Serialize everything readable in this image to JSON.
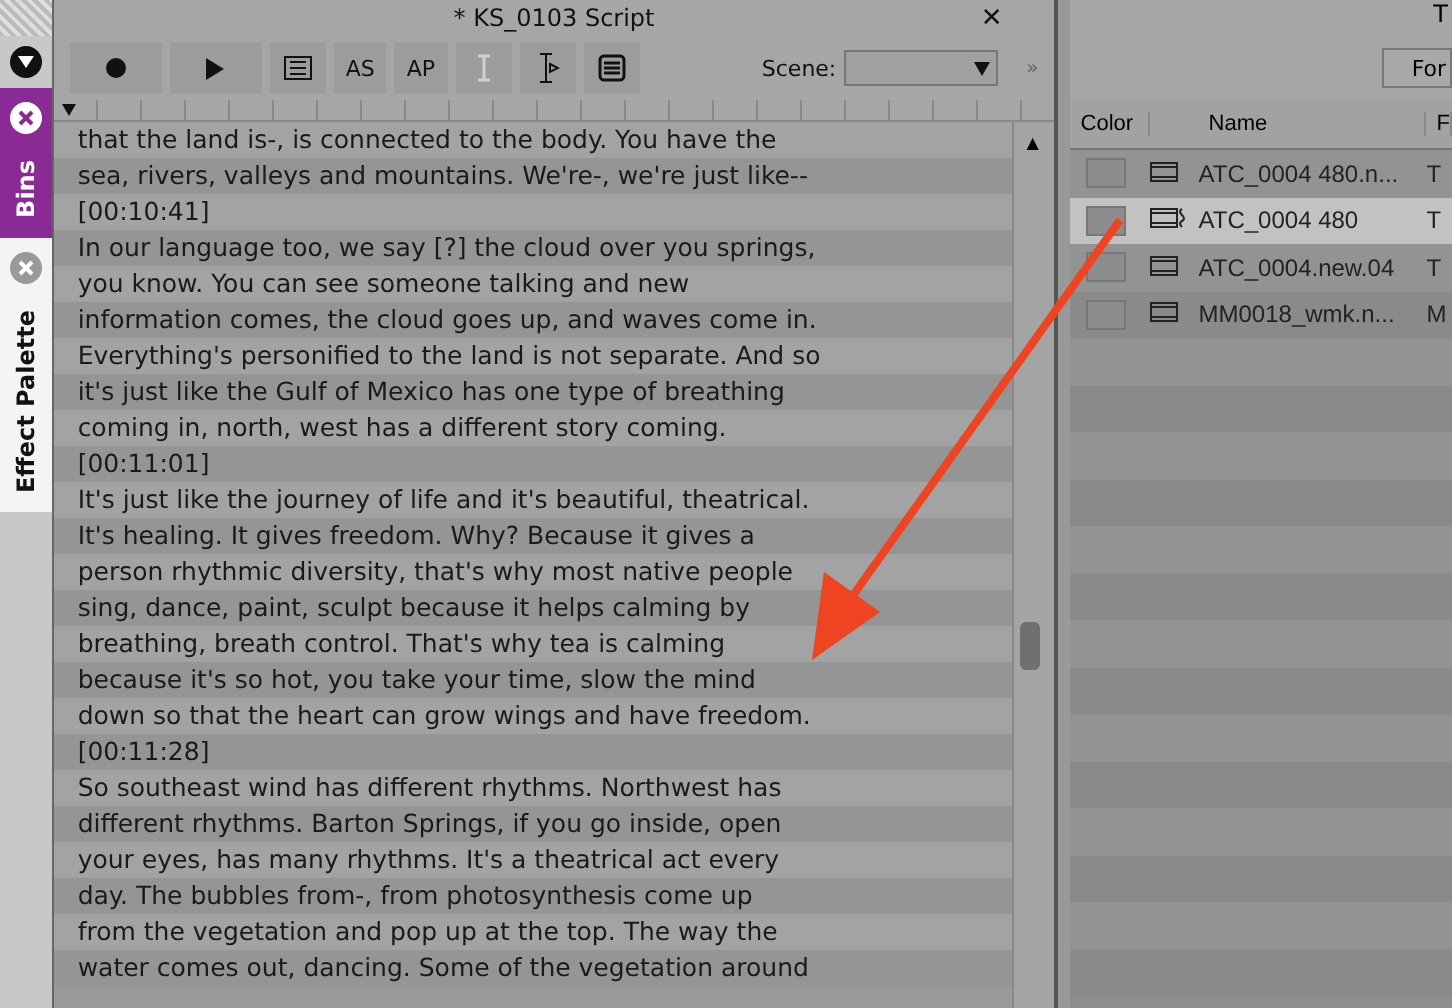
{
  "side_tabs": [
    {
      "label": "Bins",
      "selected": true
    },
    {
      "label": "Effect Palette",
      "selected": false
    }
  ],
  "script_window": {
    "title": "* KS_0103 Script",
    "close": "✕",
    "toolbar": {
      "buttons": [
        {
          "kind": "record"
        },
        {
          "kind": "play"
        },
        {
          "kind": "list"
        },
        {
          "kind": "text",
          "label": "AS"
        },
        {
          "kind": "text",
          "label": "AP"
        },
        {
          "kind": "cursor",
          "disabled": true
        },
        {
          "kind": "align",
          "disabled": false
        },
        {
          "kind": "lines"
        }
      ],
      "scene_label": "Scene:",
      "more": "»"
    },
    "scroll_up": "▲",
    "lines": [
      "that the land is-, is connected to the body.  You have the",
      "sea, rivers, valleys and mountains.  We're-, we're just like--",
      "[00:10:41]",
      "In our language too, we say [?] the cloud over you springs,",
      "you know.  You can see someone talking and new",
      "information comes, the cloud goes up, and waves come in.",
      "Everything's personified to the land is not separate.  And so",
      "it's just like the Gulf of Mexico has one type of breathing",
      "coming in, north, west has a different story coming.",
      "[00:11:01]",
      "It's just like the journey of life and it's beautiful, theatrical.",
      "It's healing.  It gives freedom.  Why?  Because it gives a",
      "person rhythmic diversity, that's why most native people",
      "sing, dance, paint, sculpt because it helps calming by",
      "breathing, breath control.  That's why tea is calming",
      "because it's so hot, you take your time, slow the mind",
      "down so that the heart can grow wings and have freedom.",
      "[00:11:28]",
      "So southeast wind has different rhythms.  Northwest has",
      "different rhythms.  Barton Springs, if you go inside, open",
      "your eyes, has many rhythms.  It's a theatrical act every",
      "day.  The bubbles from-, from photosynthesis come up",
      "from the vegetation and pop up at the top.  The way the",
      "water comes out, dancing.  Some of the vegetation around"
    ]
  },
  "bin": {
    "title": "T",
    "button": "For",
    "columns": [
      "Color",
      "Name",
      "F"
    ],
    "rows": [
      {
        "name": "ATC_0004 480.n...",
        "column_4": "T",
        "kind": "clip",
        "selected": false
      },
      {
        "name": "ATC_0004 480",
        "column_4": "T",
        "kind": "linked",
        "selected": true
      },
      {
        "name": "ATC_0004.new.04",
        "column_4": "T",
        "kind": "clip",
        "selected": false
      },
      {
        "name": "MM0018_wmk.n...",
        "column_4": "M",
        "kind": "clip",
        "selected": false
      }
    ]
  }
}
